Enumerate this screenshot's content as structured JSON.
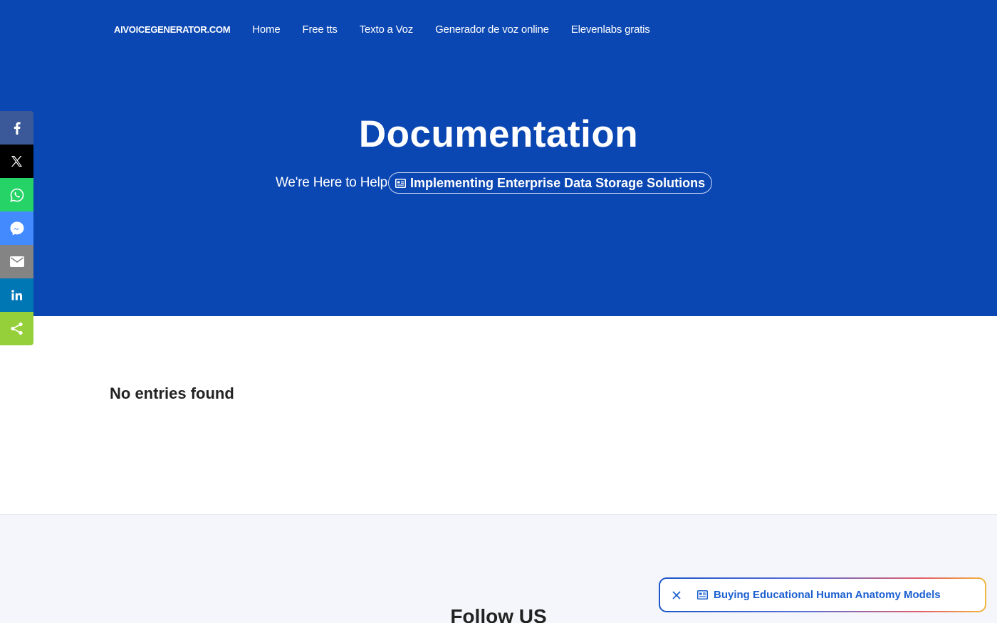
{
  "header": {
    "brand": "AIVOICEGENERATOR.COM",
    "nav": [
      "Home",
      "Free tts",
      "Texto a Voz",
      "Generador de voz online",
      "Elevenlabs gratis"
    ]
  },
  "hero": {
    "title": "Documentation",
    "subtitle": "We're Here to Help",
    "pill_label": "Implementing Enterprise Data Storage Solutions"
  },
  "share": {
    "buttons": [
      {
        "name": "facebook-icon",
        "color": "#3b5998"
      },
      {
        "name": "x-icon",
        "color": "#000000"
      },
      {
        "name": "whatsapp-icon",
        "color": "#25d366"
      },
      {
        "name": "messenger-icon",
        "color": "#448aff"
      },
      {
        "name": "email-icon",
        "color": "#848484"
      },
      {
        "name": "linkedin-icon",
        "color": "#0077b5"
      },
      {
        "name": "share-icon",
        "color": "#95d03a"
      }
    ]
  },
  "main": {
    "empty_message": "No entries found"
  },
  "footer": {
    "follow_title": "Follow US"
  },
  "toast": {
    "label": "Buying Educational Human Anatomy Models"
  },
  "colors": {
    "hero_bg": "#0b47b2",
    "toast_text": "#1a5fd0"
  }
}
